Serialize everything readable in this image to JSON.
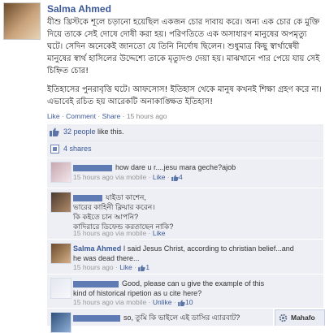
{
  "post": {
    "author": "Salma Ahmed",
    "body_lines": [
      "যীশু খ্রিস্টকে শূলে চড়ানো হয়েছিল একজন চোর দাবায় করে। অন্য এক চোর কে মুক্তি",
      "দিয়ে তাকে সেই দোষে দোষী করা হয়। পরিণতিতে এক অসাধারণ মানুষের অপমৃত্যু ঘটে।",
      "সেদিন অনেকেই জানতো যে তিনি নির্দোষ ছিলেন। শুধুমাত্র কিছু স্বার্থান্বেষী মানুষের স্বার্থ",
      "হাসিলের উদ্দেশ্যে তাকে মৃত্যুদণ্ড দেয়া হয়। মাঝখানে পার পেয়ে যায় সেই চিহ্নিত চোর!"
    ],
    "body_lines_2": [
      "ইতিহাসের পুনরাবৃত্তি ঘটে। আফসোস! ইতিহাস থেকে মানুষ কখনই শিক্ষা গ্রহণ করে না।",
      "এভাবেই রচিত হয় আরেকটি অনাকাঙ্ক্ষিত ইতিহাস!"
    ],
    "meta": {
      "like": "Like",
      "comment": "Comment",
      "share": "Share",
      "time": "15 hours ago",
      "sep": " · "
    }
  },
  "likes": {
    "count": "32 people",
    "suffix": " like this."
  },
  "shares": {
    "label": "4 shares"
  },
  "comments": [
    {
      "text_lines": [
        "how dare u r....jesu mara geche?ajob"
      ],
      "time": "15 hours ago via mobile",
      "like": "Like",
      "like_count": "4"
    },
    {
      "text_lines": [
        "যাইডা কাশেন,",
        "ভারের কাহিনী ক্লিয়ার করেন।",
        "কি কইতে চান আপনি?",
        "কাদিরারে ডিফেন্ড করতাছেন নাকি?"
      ],
      "time": "15 hours ago via mobile",
      "like": "Like"
    },
    {
      "name": "Salma Ahmed",
      "text_lines": [
        "I said Jesus Christ, according to christian belief...and",
        "he was dead there..."
      ],
      "time": "15 hours ago",
      "like": "Like",
      "like_count": "1"
    },
    {
      "text_lines": [
        "Good, please can u give the example of this",
        "kind of historical ripetion as u cite here?"
      ],
      "time": "15 hours ago via mobile",
      "like": "Unlike",
      "like_count": "10"
    },
    {
      "text_lines": [
        "so, তুমি কি ভাইলে এই ডাসির এ্যারবাট?"
      ]
    }
  ],
  "chat": {
    "name": "Mahafo"
  },
  "colors": {
    "link": "#3b5998",
    "panel": "#edeff4",
    "meta": "#999999"
  }
}
